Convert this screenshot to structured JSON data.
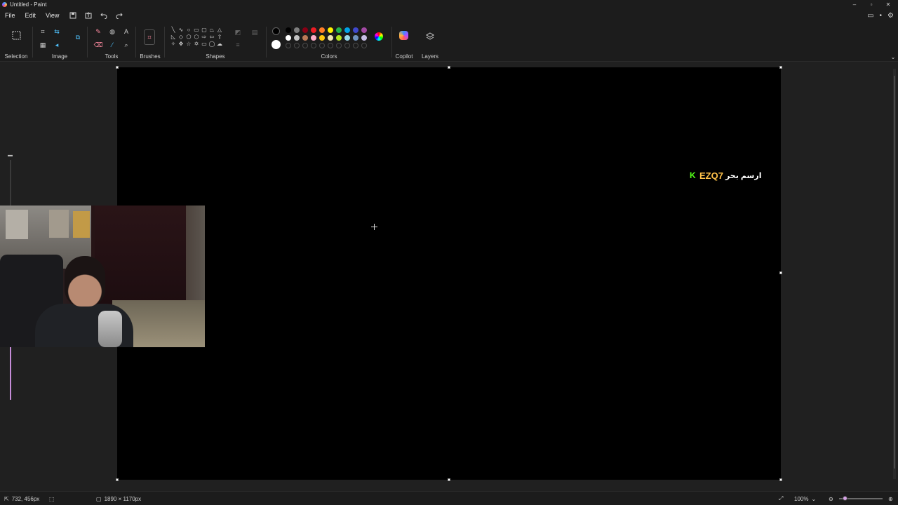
{
  "window": {
    "title": "Untitled - Paint",
    "controls": {
      "minimize": "–",
      "maximize": "▫",
      "close": "✕"
    }
  },
  "menu": {
    "items": [
      "File",
      "Edit",
      "View"
    ],
    "quick_access": [
      "save-icon",
      "share-icon",
      "undo-icon",
      "redo-icon"
    ],
    "right_icons": [
      "feedback-icon",
      "notification-icon",
      "settings-icon"
    ]
  },
  "ribbon": {
    "groups": {
      "selection": "Selection",
      "image": "Image",
      "tools": "Tools",
      "brushes": "Brushes",
      "shapes": "Shapes",
      "colors": "Colors",
      "copilot": "Copilot",
      "layers": "Layers"
    },
    "primary_color": "#000000",
    "secondary_color": "#ffffff",
    "palette_row1": [
      "#000000",
      "#7f7f7f",
      "#880015",
      "#ed1c24",
      "#ff7f27",
      "#fff200",
      "#22b14c",
      "#00a2e8",
      "#3f48cc",
      "#a349a4"
    ],
    "palette_row2": [
      "#ffffff",
      "#c3c3c3",
      "#b97a57",
      "#ffaec9",
      "#ffc90e",
      "#efe4b0",
      "#b5e61d",
      "#99d9ea",
      "#7092be",
      "#c8bfe7"
    ]
  },
  "canvas": {
    "background": "#000000",
    "overlay": {
      "brand": "EZQ7",
      "arabic": "ارسم بحر",
      "kick_icon": "K",
      "kick_color": "#53fc18",
      "brand_color": "#ffc24a"
    }
  },
  "status": {
    "cursor_position": "732, 456px",
    "canvas_size": "1890 × 1170px",
    "zoom": "100%"
  }
}
